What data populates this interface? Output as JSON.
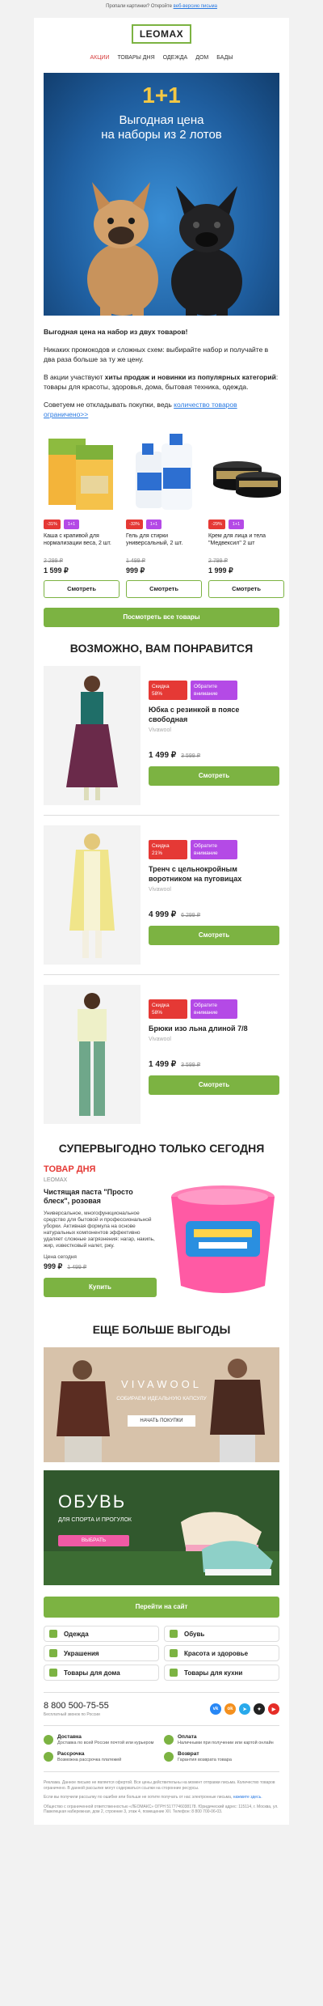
{
  "preheader": {
    "text": "Пропали картинки? Откройте ",
    "link": "веб-версию письма"
  },
  "header": {
    "logo": "LEOMAX",
    "nav": [
      "АКЦИИ",
      "ТОВАРЫ ДНЯ",
      "ОДЕЖДА",
      "ДОМ",
      "БАДЫ"
    ]
  },
  "hero": {
    "big": "1+1",
    "line1": "Выгодная цена",
    "line2": "на наборы из 2 лотов"
  },
  "intro": {
    "p1": "Выгодная цена на набор из двух товаров!",
    "p2": "Никаких промокодов и сложных схем: выбирайте набор и получайте в два раза больше за ту же цену.",
    "p3_a": "В акции участвуют ",
    "p3_b": "хиты продаж и новинки из популярных категорий",
    "p3_c": ": товары для красоты, здоровья, дома, бытовая техника, одежда.",
    "p4_a": "Советуем не откладывать покупки, ведь ",
    "p4_link": "количество товаров ограничено>>"
  },
  "products": [
    {
      "discount": "-31%",
      "tag": "1+1",
      "name": "Каша с крапивой для нормализации веса, 2 шт.",
      "old": "2 299 ₽",
      "price": "1 599 ₽",
      "btn": "Смотреть"
    },
    {
      "discount": "-33%",
      "tag": "1+1",
      "name": "Гель для стирки универсальный, 2 шт.",
      "old": "1 499 ₽",
      "price": "999 ₽",
      "btn": "Смотреть"
    },
    {
      "discount": "-29%",
      "tag": "1+1",
      "name": "Крем для лица и тела \"Медвексил\" 2 шт",
      "old": "2 799 ₽",
      "price": "1 999 ₽",
      "btn": "Смотреть"
    }
  ],
  "all_button": "Посмотреть все товары",
  "recommend": {
    "title": "ВОЗМОЖНО, ВАМ ПОНРАВИТСЯ",
    "items": [
      {
        "sale_1": "Скидка",
        "sale_2": "58%",
        "attn_1": "Обратите",
        "attn_2": "внимание",
        "name": "Юбка с резинкой в поясе свободная",
        "brand": "Vivawool",
        "price": "1 499 ₽",
        "old": "3 599 ₽",
        "btn": "Смотреть"
      },
      {
        "sale_1": "Скидка",
        "sale_2": "21%",
        "attn_1": "Обратите",
        "attn_2": "внимание",
        "name": "Тренч с цельнокройным воротником на пуговицах",
        "brand": "Vivawool",
        "price": "4 999 ₽",
        "old": "6 299 ₽",
        "btn": "Смотреть"
      },
      {
        "sale_1": "Скидка",
        "sale_2": "58%",
        "attn_1": "Обратите",
        "attn_2": "внимание",
        "name": "Брюки изо льна длиной 7/8",
        "brand": "Vivawool",
        "price": "1 499 ₽",
        "old": "3 599 ₽",
        "btn": "Смотреть"
      }
    ]
  },
  "deal": {
    "title": "СУПЕРВЫГОДНО ТОЛЬКО СЕГОДНЯ",
    "tag": "ТОВАР ДНЯ",
    "brand": "LEOMAX",
    "name": "Чистящая паста \"Просто блеск\", розовая",
    "desc": "Универсальное, многофункциональное средство для бытовой и профессиональной уборки. Активная формула на основе натуральных компонентов эффективно удаляет сложные загрязнения: нагар, накипь, жир, известковый налет, ржу.",
    "price_label": "Цена сегодня",
    "price": "999 ₽",
    "old": "1 499 ₽",
    "btn": "Купить"
  },
  "more": {
    "title": "ЕЩЕ БОЛЬШЕ ВЫГОДЫ",
    "banner1_brand": "VIVAWOOL",
    "banner1_text": "СОБИРАЕМ ИДЕАЛЬНУЮ КАПСУЛУ",
    "banner1_btn": "НАЧАТЬ ПОКУПКИ",
    "banner2_title": "ОБУВЬ",
    "banner2_sub": "ДЛЯ СПОРТА И ПРОГУЛОК",
    "banner2_btn": "ВЫБРАТЬ"
  },
  "site_button": "Перейти на сайт",
  "categories": [
    "Одежда",
    "Обувь",
    "Украшения",
    "Красота и здоровье",
    "Товары для дома",
    "Товары для кухни"
  ],
  "footer": {
    "phone": "8 800 500-75-55",
    "phone_note": "Бесплатный звонок по России",
    "socials": [
      "vk",
      "ok",
      "tg",
      "dzen",
      "yt"
    ],
    "features": [
      {
        "title": "Доставка",
        "sub": "Доставка по всей России почтой или курьером"
      },
      {
        "title": "Оплата",
        "sub": "Наличными при получении или картой онлайн"
      },
      {
        "title": "Рассрочка",
        "sub": "Возможна рассрочка платежей"
      },
      {
        "title": "Возврат",
        "sub": "Гарантия возврата товара"
      }
    ],
    "fine1": "Реклама. Данное письмо не является офертой. Все цены действительны на момент отправки письма. Количество товаров ограничено. В данной рассылке могут содержаться ссылки на сторонние ресурсы.",
    "fine2": "Если вы получили рассылку по ошибке или больше не хотите получать от нас электронные письма, ",
    "fine2_link": "нажмите здесь.",
    "fine3": "Общество с ограниченной ответственностью «ЛЕОМАКС» ОГРН 5177746038178. Юридический адрес: 115114, г. Москва, ул. Павелецкая набережная, дом 2, строение 3, этаж 4, помещение XII. Телефон: 8 800 700-06-03."
  },
  "colors": {
    "accent_green": "#7cb342",
    "sale_red": "#e53935",
    "attn_purple": "#b44ae6",
    "link_blue": "#2a7ae2"
  }
}
